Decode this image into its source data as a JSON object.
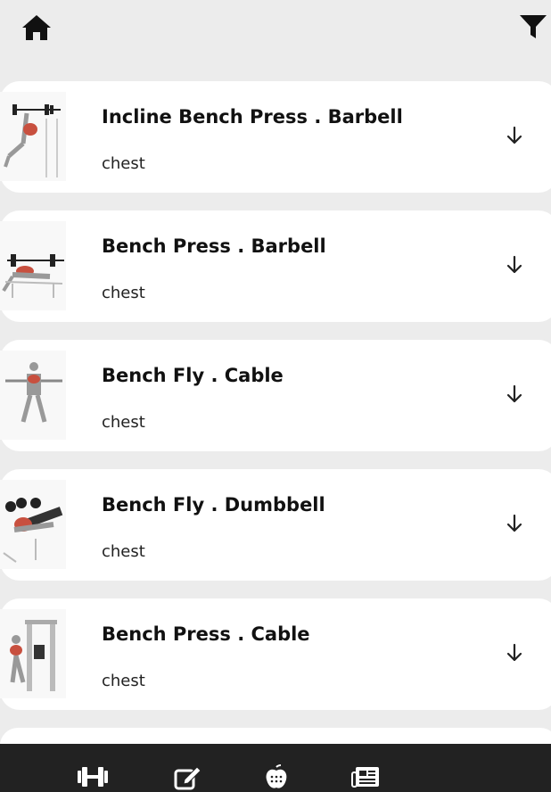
{
  "header": {
    "home_icon": "home-icon",
    "filter_icon": "filter-icon"
  },
  "exercises": [
    {
      "name": "Incline Bench Press . Barbell",
      "muscle": "chest"
    },
    {
      "name": "Bench Press . Barbell",
      "muscle": "chest"
    },
    {
      "name": "Bench Fly . Cable",
      "muscle": "chest"
    },
    {
      "name": "Bench Fly . Dumbbell",
      "muscle": "chest"
    },
    {
      "name": "Bench Press . Cable",
      "muscle": "chest"
    }
  ],
  "bottom_nav": [
    "dumbbell-icon",
    "edit-icon",
    "nutrition-icon",
    "news-icon"
  ],
  "colors": {
    "background": "#ececec",
    "card": "#ffffff",
    "nav_bar": "#222222",
    "text": "#111111"
  }
}
